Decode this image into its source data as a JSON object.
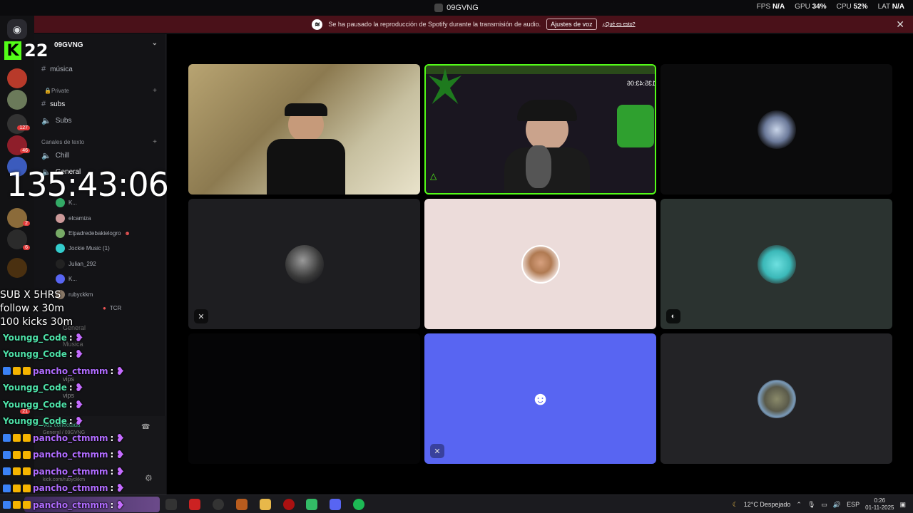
{
  "window": {
    "title": "09GVNG",
    "perf": [
      {
        "label": "FPS",
        "value": "N/A"
      },
      {
        "label": "GPU",
        "value": "34%"
      },
      {
        "label": "CPU",
        "value": "52%"
      },
      {
        "label": "LAT",
        "value": "N/A"
      }
    ]
  },
  "notice": {
    "text": "Se ha pausado la reproducción de Spotify durante la transmisión de audio.",
    "button": "Ajustes de voz",
    "link": "¿Qué es esto?",
    "close": "✕"
  },
  "server_rail": {
    "badges": [
      "127",
      "46",
      "2",
      "6",
      "21"
    ]
  },
  "sidebar": {
    "server_name": "09GVNG",
    "channels": [
      {
        "name": "música",
        "type": "text"
      },
      {
        "category": "Private"
      },
      {
        "name": "subs",
        "type": "text"
      },
      {
        "name": "Subs",
        "type": "voice"
      },
      {
        "category": "Canales de texto"
      },
      {
        "name": "Chill",
        "type": "voice"
      },
      {
        "name": "General",
        "type": "voice"
      }
    ],
    "voice_users": [
      "elcamiza",
      "Elpadredebakielogro",
      "Jockie Music (1)",
      "Julian_292",
      "rubyckkm"
    ],
    "voice_user_extras": [
      "K...",
      "TCR"
    ],
    "bottom_channels": [
      "General",
      "Musica",
      "vips",
      "vips"
    ],
    "voice_status": "Voz conectada",
    "voice_location": "General / 09GVNG",
    "user_profile": "kick.com/rubyckkm"
  },
  "overlay": {
    "kick_logo": "K",
    "kick_count": "22",
    "timer": "135:43:06",
    "goals": [
      "SUB X 5HRS",
      "follow x 30m",
      "100 kicks 30m"
    ],
    "chat": [
      {
        "user": "Youngg_Code",
        "color": "#4ee1a8",
        "badges": false
      },
      {
        "user": "Youngg_Code",
        "color": "#4ee1a8",
        "badges": false
      },
      {
        "user": "pancho_ctmmm",
        "color": "#b06cff",
        "badges": true
      },
      {
        "user": "Youngg_Code",
        "color": "#4ee1a8",
        "badges": false
      },
      {
        "user": "Youngg_Code",
        "color": "#4ee1a8",
        "badges": false
      },
      {
        "user": "Youngg_Code",
        "color": "#4ee1a8",
        "badges": false
      },
      {
        "user": "pancho_ctmmm",
        "color": "#b06cff",
        "badges": true
      },
      {
        "user": "pancho_ctmmm",
        "color": "#b06cff",
        "badges": true
      },
      {
        "user": "pancho_ctmmm",
        "color": "#b06cff",
        "badges": true
      },
      {
        "user": "pancho_ctmmm",
        "color": "#b06cff",
        "badges": true
      },
      {
        "user": "pancho_ctmmm",
        "color": "#b06cff",
        "badges": true
      }
    ],
    "chat_separator": " :"
  },
  "stream_overlay": {
    "timer": "135:43:06"
  },
  "taskbar": {
    "weather": "12°C  Despejado",
    "lang": "ESP",
    "time": "0:26",
    "date": "01-11-2025"
  },
  "colors": {
    "accent": "#5865f2",
    "kick_green": "#53fc18",
    "notice_bg": "#4a1119"
  }
}
